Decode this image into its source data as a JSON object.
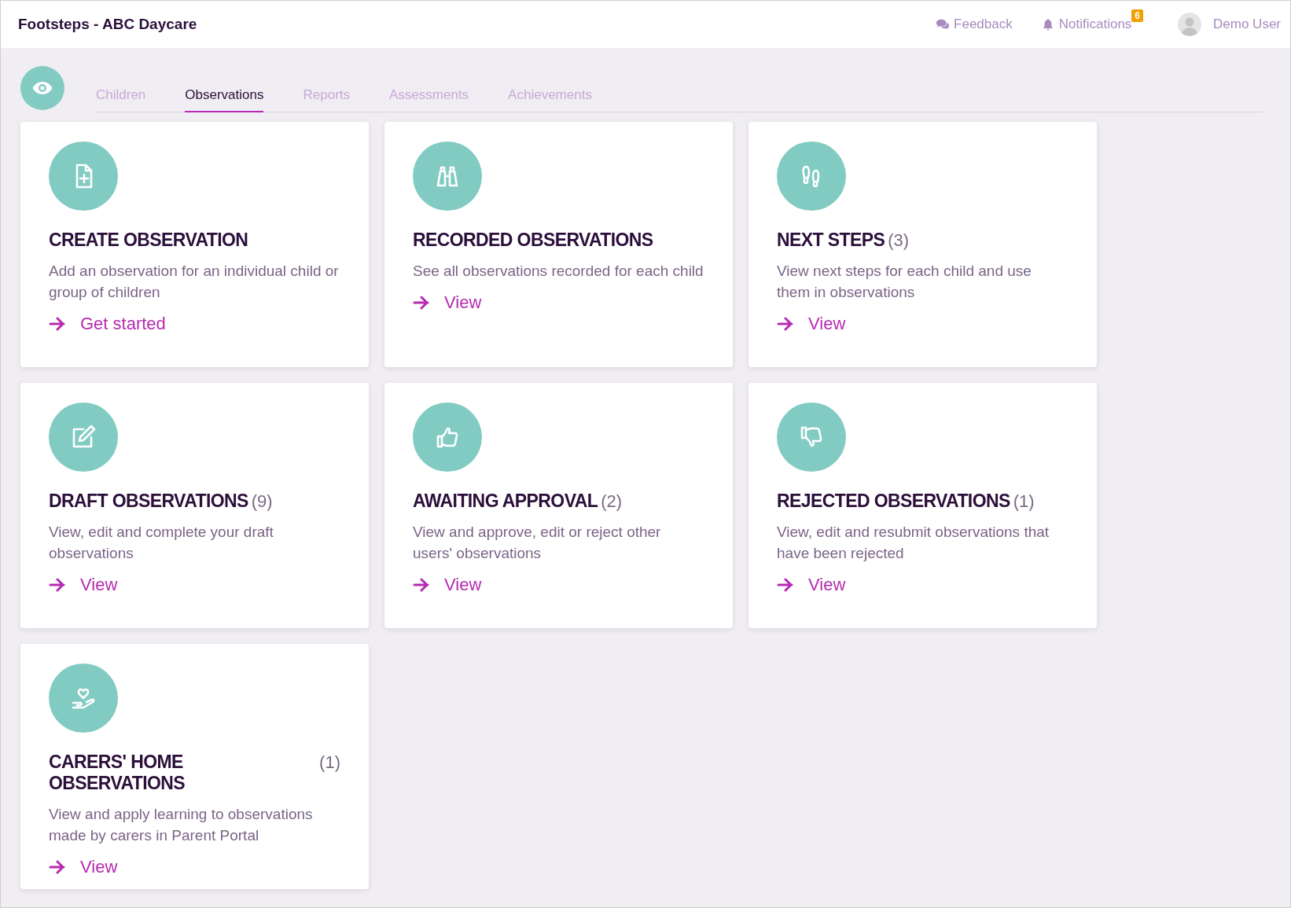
{
  "header": {
    "title": "Footsteps - ABC Daycare",
    "feedback": "Feedback",
    "notifications": {
      "label": "Notifications",
      "count": "6"
    },
    "user": "Demo User"
  },
  "tabs": [
    {
      "label": "Children",
      "selected": false
    },
    {
      "label": "Observations",
      "selected": true
    },
    {
      "label": "Reports",
      "selected": false
    },
    {
      "label": "Assessments",
      "selected": false
    },
    {
      "label": "Achievements",
      "selected": false
    }
  ],
  "cards": [
    {
      "title": "CREATE OBSERVATION",
      "description": "Add an observation for an individual child or group of children",
      "link": "Get started"
    },
    {
      "title": "RECORDED OBSERVATIONS",
      "description": "See all observations recorded for each child",
      "link": "View"
    },
    {
      "title": "NEXT STEPS",
      "count": "(3)",
      "description": "View next steps for each child and use them in observations",
      "link": "View"
    },
    {
      "title": "DRAFT OBSERVATIONS",
      "count": "(9)",
      "description": "View, edit and complete your draft observations",
      "link": "View"
    },
    {
      "title": "AWAITING APPROVAL",
      "count": "(2)",
      "description": "View and approve, edit or reject other users' observations",
      "link": "View"
    },
    {
      "title": "REJECTED OBSERVATIONS",
      "count": "(1)",
      "description": "View, edit and resubmit observations that have been rejected",
      "link": "View"
    },
    {
      "title": "CARERS' HOME OBSERVATIONS",
      "count": "(1)",
      "description": "View and apply learning to observations made by carers in Parent Portal",
      "link": "View"
    }
  ]
}
